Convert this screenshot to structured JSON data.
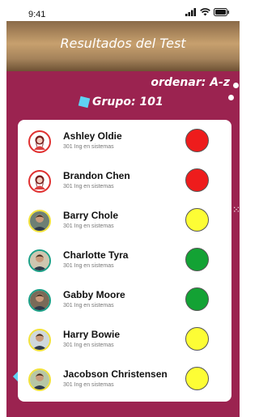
{
  "status_bar": {
    "time": "9:41"
  },
  "header": {
    "title": "Resultados del Test"
  },
  "sort": {
    "label": "ordenar: A-z"
  },
  "group": {
    "label": "Grupo: 101"
  },
  "colors": {
    "panel": "#9b2350",
    "red": "#ee1c1c",
    "yellow": "#fdfd35",
    "green": "#13a234",
    "accent": "#5fd3f3"
  },
  "students": [
    {
      "name": "Ashley Oldie",
      "subtitle": "301 Ing en sistemas",
      "status": "red",
      "avatar": "woman-icon",
      "ring": "#e03030"
    },
    {
      "name": "Brandon Chen",
      "subtitle": "301 Ing en sistemas",
      "status": "red",
      "avatar": "woman-icon",
      "ring": "#e03030"
    },
    {
      "name": "Barry Chole",
      "subtitle": "301 Ing en sistemas",
      "status": "yellow",
      "avatar": "man-photo-icon",
      "ring": "#f2e23a"
    },
    {
      "name": "Charlotte Tyra",
      "subtitle": "301 Ing en sistemas",
      "status": "green",
      "avatar": "man-photo-icon",
      "ring": "#1aa087"
    },
    {
      "name": "Gabby Moore",
      "subtitle": "301 Ing en sistemas",
      "status": "green",
      "avatar": "man-photo-icon",
      "ring": "#1aa087"
    },
    {
      "name": "Harry Bowie",
      "subtitle": "301 Ing en sistemas",
      "status": "yellow",
      "avatar": "man-photo-icon",
      "ring": "#f2e23a"
    },
    {
      "name": "Jacobson Christensen",
      "subtitle": "301 Ing en sistemas",
      "status": "yellow",
      "avatar": "man-photo-icon",
      "ring": "#f2e23a"
    }
  ]
}
